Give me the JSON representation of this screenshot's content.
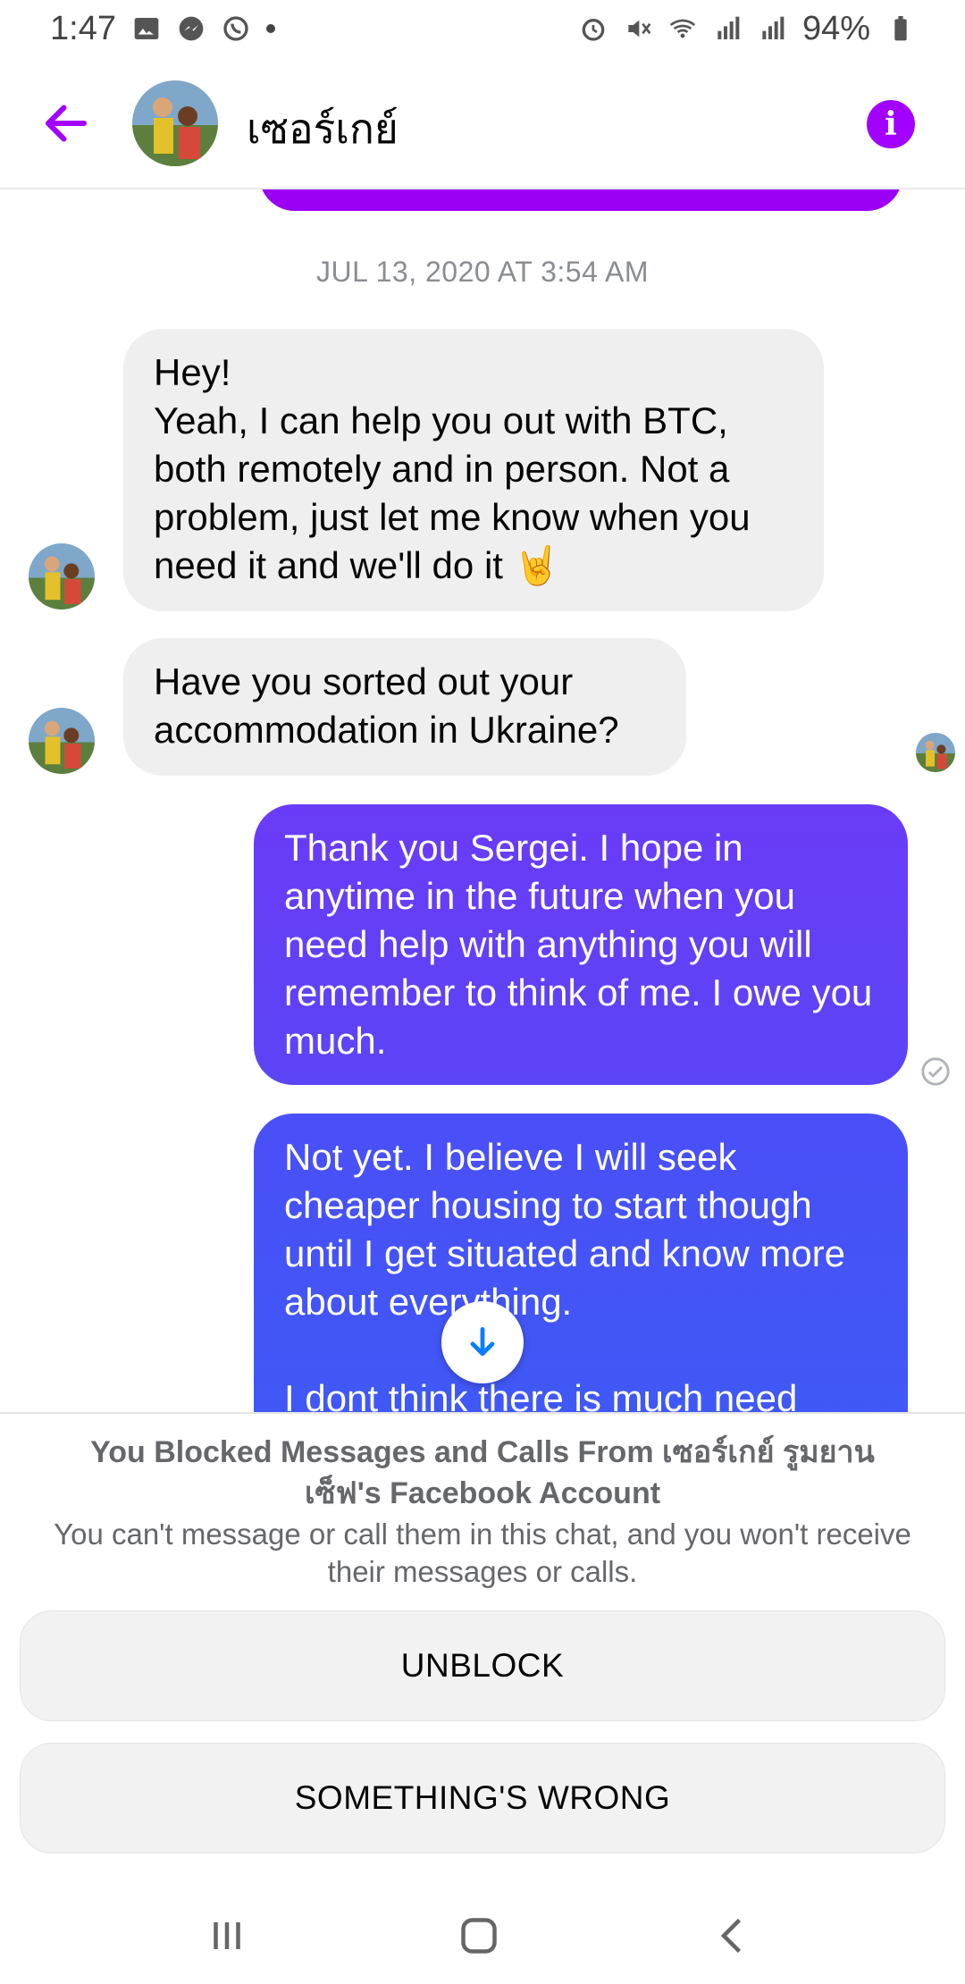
{
  "status_bar": {
    "time": "1:47",
    "battery": "94%",
    "left_icons": [
      "gallery-icon",
      "messenger-icon",
      "whatsapp-icon",
      "dot-icon"
    ],
    "right_icons": [
      "alarm-icon",
      "mute-icon",
      "wifi-icon",
      "signal-icon",
      "signal-icon",
      "battery-icon"
    ]
  },
  "header": {
    "contact_name": "เซอร์เกย์",
    "back_icon": "arrow-left-icon",
    "info_icon": "info-icon",
    "accent_color": "#a200ff"
  },
  "conversation": {
    "timestamp": "JUL 13, 2020 AT 3:54 AM",
    "messages": [
      {
        "direction": "incoming",
        "text": "Hey!\nYeah, I can help you out with BTC, both remotely and in person. Not a problem, just let me know when you need it and we'll do it 🤘"
      },
      {
        "direction": "incoming",
        "text": "Have you sorted out your accommodation in Ukraine?"
      },
      {
        "direction": "outgoing",
        "text": "Thank you Sergei. I hope in anytime in the future when you need help with anything you will remember to think of me. I owe you much."
      },
      {
        "direction": "outgoing",
        "text": "Not yet. I believe I will seek cheaper housing to start though until I get situated and know more about everything.\n\nI dont think there is much need"
      }
    ],
    "scroll_down_icon": "arrow-down-icon",
    "sent_icon": "check-circle-icon"
  },
  "blocked_panel": {
    "title": "You Blocked Messages and Calls From เซอร์เกย์ รูมยาน เซ็ฟ's Facebook Account",
    "description": "You can't message or call them in this chat, and you won't receive their messages or calls.",
    "unblock_label": "UNBLOCK",
    "wrong_label": "SOMETHING'S WRONG"
  },
  "nav_bar": {
    "icons": [
      "recents-icon",
      "home-icon",
      "back-icon"
    ]
  }
}
